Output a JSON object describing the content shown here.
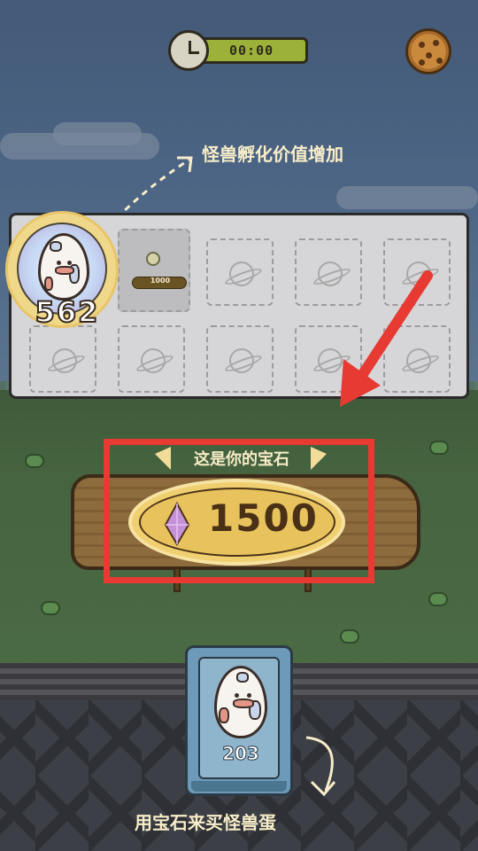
{
  "hud": {
    "timer": "00:00",
    "clock_icon": "clock-icon",
    "settings_icon": "cookie-gear-icon"
  },
  "hints": {
    "top": "怪兽孵化价值增加",
    "bottom": "用宝石来买怪兽蛋"
  },
  "incubator": {
    "badge_value": "562",
    "slot_price": "1000",
    "slot_icon": "planet-icon"
  },
  "gems": {
    "ribbon_label": "这是你的宝石",
    "amount": "1500",
    "gem_icon": "purple-gem-icon"
  },
  "shop_card": {
    "price": "203",
    "egg_icon": "monster-egg-icon"
  },
  "colors": {
    "highlight": "#e63a33",
    "hint_text": "#f7edc9",
    "timer_bar": "#9cb13a"
  }
}
